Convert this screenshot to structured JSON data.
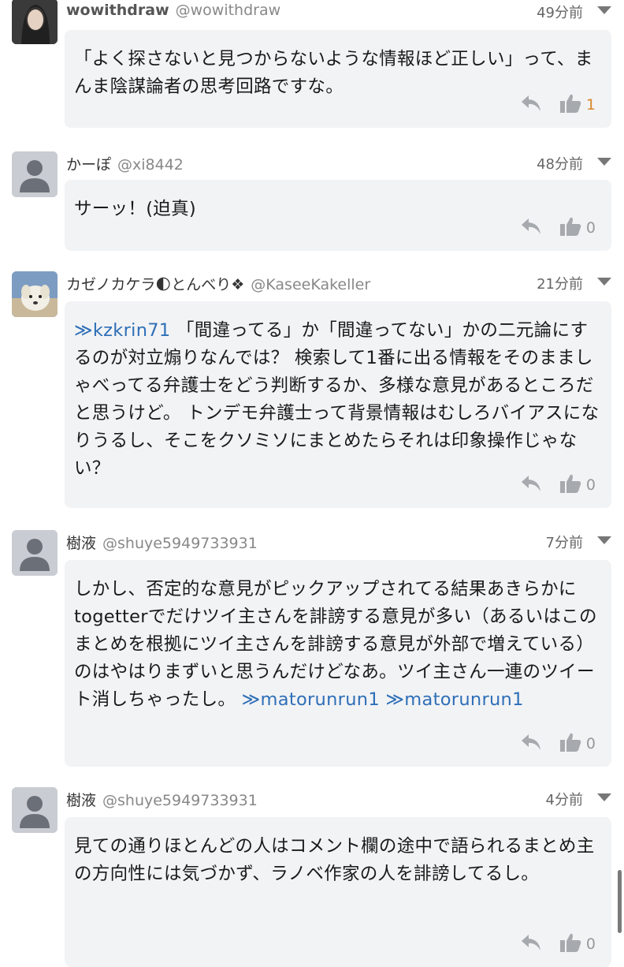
{
  "comments": [
    {
      "display_name": "wowithdraw",
      "handle": "@wowithdraw",
      "time": "49分前",
      "segments": [
        {
          "type": "text",
          "text": "「よく探さないと見つからないような情報ほど正しい」って、まんま陰謀論者の思考回路ですな。"
        }
      ],
      "like_count": "1",
      "avatar": "photo-avatar-woman"
    },
    {
      "display_name": "かーぽ",
      "handle": "@xi8442",
      "time": "48分前",
      "segments": [
        {
          "type": "text",
          "text": "サーッ！(迫真)"
        }
      ],
      "like_count": "0",
      "avatar": "default-user-avatar"
    },
    {
      "display_name": "カゼノカケラ🌓とんべり❖",
      "handle": "@KaseeKakeller",
      "time": "21分前",
      "segments": [
        {
          "type": "mention",
          "text": "≫kzkrin71"
        },
        {
          "type": "text",
          "text": " 「間違ってる」か「間違ってない」かの二元論にするのが対立煽りなんでは？ 検索して1番に出る情報をそのまましゃべってる弁護士をどう判断するか、多様な意見があるところだと思うけど。 トンデモ弁護士って背景情報はむしろバイアスになりうるし、そこをクソミソにまとめたらそれは印象操作じゃない？"
        }
      ],
      "like_count": "0",
      "avatar": "photo-avatar-dog"
    },
    {
      "display_name": "樹液",
      "handle": "@shuye5949733931",
      "time": "7分前",
      "segments": [
        {
          "type": "text",
          "text": "しかし、否定的な意見がピックアップされてる結果あきらかにtogetterでだけツイ主さんを誹謗する意見が多い（あるいはこのまとめを根拠にツイ主さんを誹謗する意見が外部で増えている）のはやはりまずいと思うんだけどなあ。ツイ主さん一連のツイート消しちゃったし。 "
        },
        {
          "type": "mention",
          "text": "≫matorunrun1"
        },
        {
          "type": "text",
          "text": " "
        },
        {
          "type": "mention",
          "text": "≫matorunrun1"
        }
      ],
      "like_count": "0",
      "avatar": "default-user-avatar"
    },
    {
      "display_name": "樹液",
      "handle": "@shuye5949733931",
      "time": "4分前",
      "segments": [
        {
          "type": "text",
          "text": "見ての通りほとんどの人はコメント欄の途中で語られるまとめ主の方向性には気づかず、ラノベ作家の人を誹謗してるし。"
        }
      ],
      "like_count": "0",
      "avatar": "default-user-avatar"
    }
  ],
  "colors": {
    "mention": "#2e6fb7",
    "like_active": "#d9892b",
    "bubble_bg": "#f2f3f5"
  },
  "icons": [
    "reply-icon",
    "thumbs-up-icon",
    "chevron-down-icon",
    "user-icon"
  ]
}
